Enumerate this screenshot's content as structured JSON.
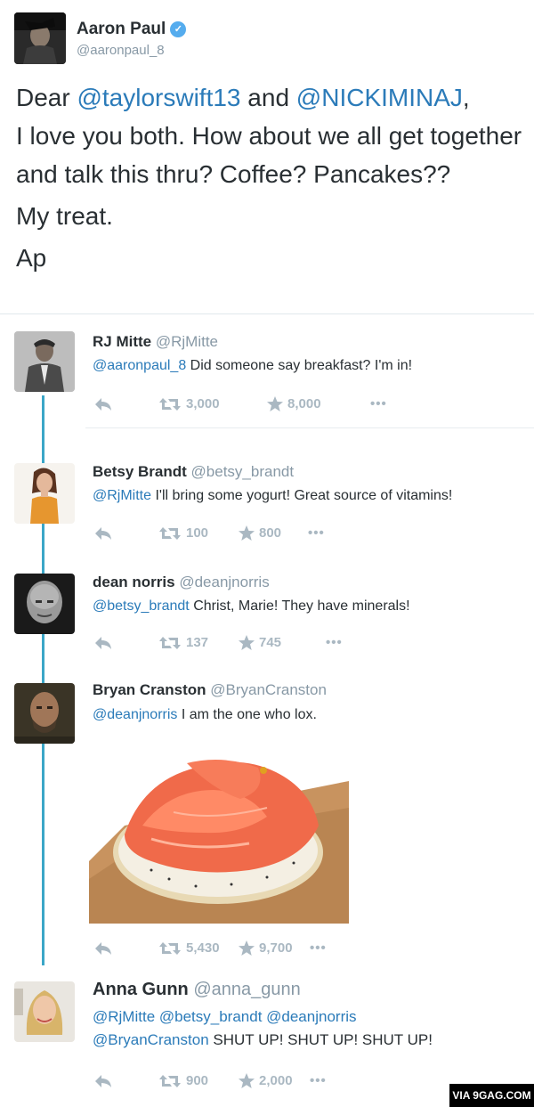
{
  "main_tweet": {
    "name": "Aaron Paul",
    "handle": "@aaronpaul_8",
    "text_prefix": "Dear ",
    "mention1": "@taylorswift13",
    "conj": " and ",
    "mention2": "@NICKIMINAJ",
    "comma": ",",
    "line2": "I love you both. How about we all get together and talk this thru? Coffee? Pancakes??",
    "line3": "My treat.",
    "line4": "Ap"
  },
  "replies": [
    {
      "name": "RJ Mitte",
      "handle": "@RjMitte",
      "mentions": "@aaronpaul_8",
      "text": " Did someone say breakfast? I'm in!",
      "retweets": "3,000",
      "favorites": "8,000"
    },
    {
      "name": "Betsy Brandt",
      "handle": "@betsy_brandt",
      "mentions": "@RjMitte",
      "text": " I'll bring some yogurt! Great source of vitamins!",
      "retweets": "100",
      "favorites": "800"
    },
    {
      "name": "dean norris",
      "handle": "@deanjnorris",
      "mentions": "@betsy_brandt",
      "text": " Christ, Marie! They have minerals!",
      "retweets": "137",
      "favorites": "745"
    },
    {
      "name": "Bryan Cranston",
      "handle": "@BryanCranston",
      "mentions": "@deanjnorris",
      "text": " I am the one who lox.",
      "retweets": "5,430",
      "favorites": "9,700"
    },
    {
      "name": "Anna Gunn",
      "handle": "@anna_gunn",
      "mentions_line1": "@RjMitte @betsy_brandt @deanjnorris",
      "mentions_line2": "@BryanCranston",
      "text": " SHUT UP! SHUT UP! SHUT UP!",
      "retweets": "900",
      "favorites": "2,000"
    }
  ],
  "icons": {
    "reply": "reply-icon",
    "retweet": "retweet-icon",
    "favorite": "star-icon",
    "more": "more-icon",
    "verified": "verified-icon"
  },
  "colors": {
    "mention": "#2b7bb9",
    "thread_line": "#3ba6c7",
    "action_gray": "#aab8c2",
    "verified": "#55acee"
  },
  "watermark": "VIA 9GAG.COM"
}
